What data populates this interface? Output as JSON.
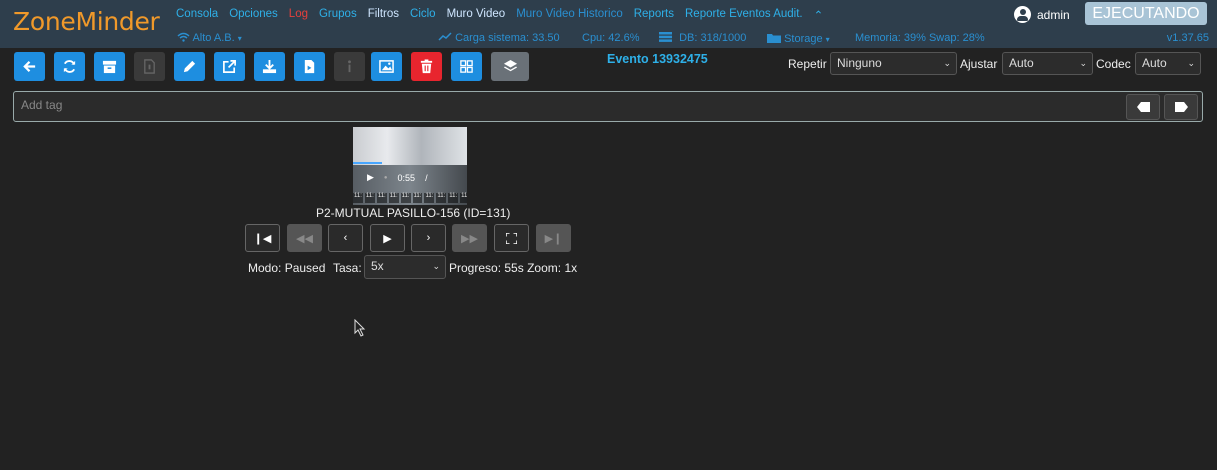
{
  "header": {
    "logo": "ZoneMinder",
    "nav": [
      {
        "label": "Consola",
        "style": "link"
      },
      {
        "label": "Opciones",
        "style": "link"
      },
      {
        "label": "Log",
        "style": "log"
      },
      {
        "label": "Grupos",
        "style": "link"
      },
      {
        "label": "Filtros",
        "style": "white"
      },
      {
        "label": "Ciclo",
        "style": "link"
      },
      {
        "label": "Muro Video",
        "style": "white"
      },
      {
        "label": "Muro Video Historico",
        "style": "link"
      },
      {
        "label": "Reports",
        "style": "link"
      },
      {
        "label": "Reporte Eventos Audit.",
        "style": "link"
      }
    ],
    "nav_collapse": "⌃",
    "user": "admin",
    "state_button": "EJECUTANDO",
    "status": {
      "bandwidth": "Alto A.B.",
      "load": "Carga sistema: 33.50",
      "cpu": "Cpu: 42.6%",
      "db": "DB: 318/1000",
      "storage": "Storage",
      "memory": "Memoria: 39% Swap: 28%"
    },
    "version": "v1.37.65"
  },
  "toolbar": {
    "event_title": "Evento 13932475",
    "repeat_label": "Repetir",
    "repeat_value": "Ninguno",
    "fit_label": "Ajustar",
    "fit_value": "Auto",
    "codec_label": "Codec",
    "codec_value": "Auto",
    "colors": {
      "blue": "#1e8ee0",
      "red": "#e8252e",
      "grey": "#6a7178"
    }
  },
  "tags": {
    "placeholder": "Add tag"
  },
  "video": {
    "time": "0:55",
    "progress_fraction": 0.25,
    "ticks": [
      "11:",
      "11:",
      "11:",
      "11:",
      "11:",
      "11:",
      "11:",
      "11:",
      "11:",
      "11:",
      "11:"
    ],
    "camera_name": "P2-MUTUAL PASILLO-156 (ID=131)"
  },
  "playback": {
    "mode_label": "Modo:",
    "mode_value": "Paused",
    "rate_label": "Tasa:",
    "rate_value": "5x",
    "progress_label": "Progreso:",
    "progress_value": "55s",
    "zoom_label": "Zoom:",
    "zoom_value": "1x"
  }
}
